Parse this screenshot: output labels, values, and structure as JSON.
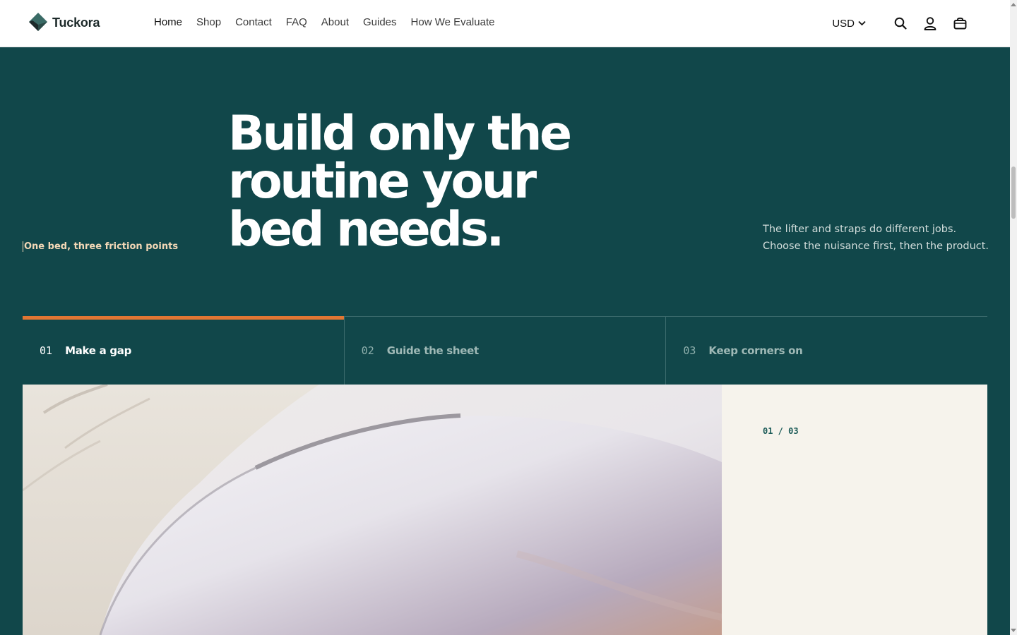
{
  "brand": {
    "name": "Tuckora"
  },
  "nav": [
    {
      "label": "Home"
    },
    {
      "label": "Shop"
    },
    {
      "label": "Contact"
    },
    {
      "label": "FAQ"
    },
    {
      "label": "About"
    },
    {
      "label": "Guides"
    },
    {
      "label": "How We Evaluate"
    }
  ],
  "toolbar": {
    "currency": "USD",
    "icons": [
      "search-icon",
      "account-icon",
      "cart-icon"
    ]
  },
  "hero": {
    "eyebrow": "One bed, three friction points",
    "headline": "Build only the routine your bed needs.",
    "subcopy": "The lifter and straps do different jobs. Choose the nuisance first, then the product."
  },
  "tabs": [
    {
      "num": "01",
      "label": "Make a gap",
      "active": true
    },
    {
      "num": "02",
      "label": "Guide the sheet",
      "active": false
    },
    {
      "num": "03",
      "label": "Keep corners on",
      "active": false
    }
  ],
  "panel": {
    "counter": "01 / 03"
  },
  "colors": {
    "hero_bg": "#11474a",
    "accent": "#e27633",
    "eyebrow": "#f2d7b6",
    "panel_bg": "#f6f3ec"
  }
}
